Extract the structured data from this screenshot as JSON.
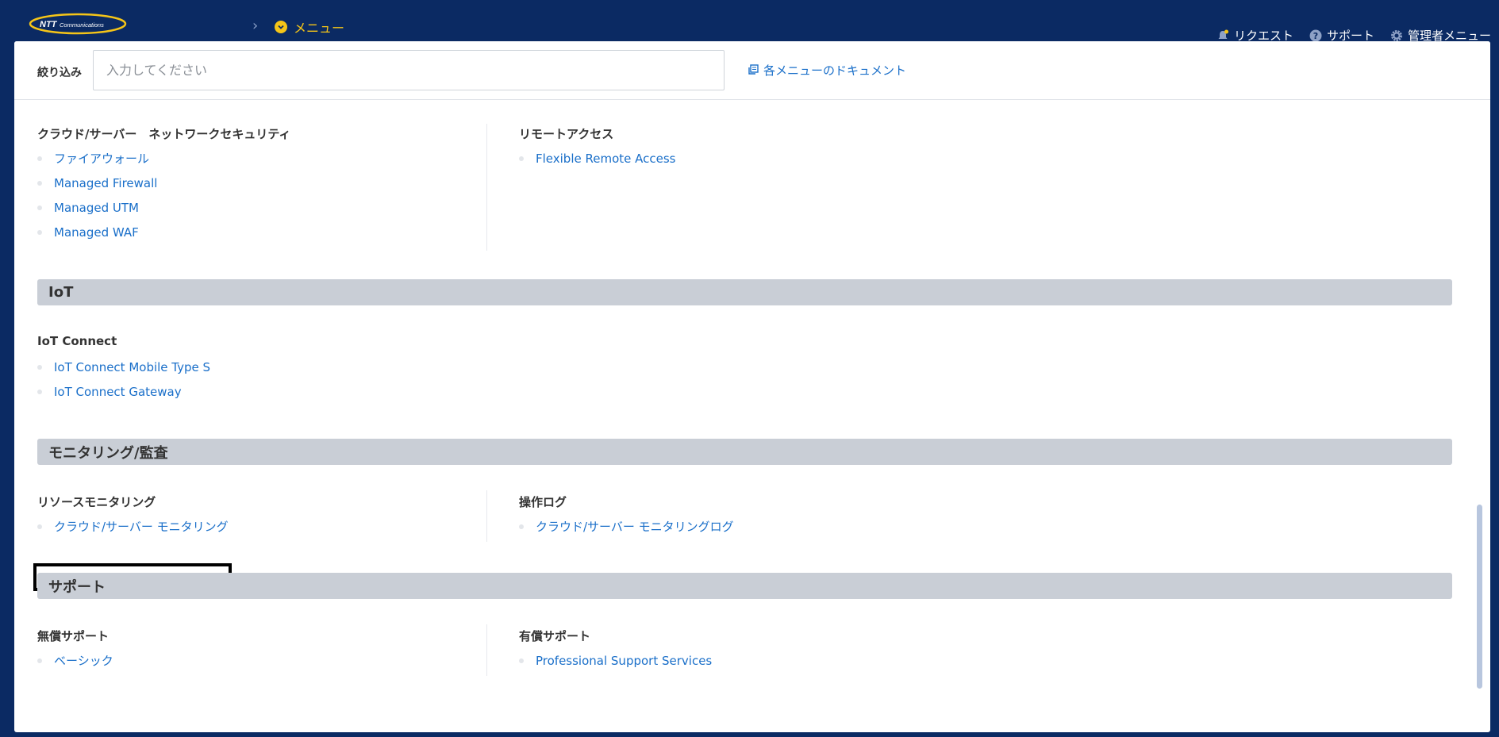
{
  "header": {
    "logo_text": "NTT Communications",
    "breadcrumb_menu": "メニュー",
    "right_items": [
      {
        "label": "リクエスト",
        "icon": "bell-icon"
      },
      {
        "label": "サポート",
        "icon": "help-icon"
      },
      {
        "label": "管理者メニュー",
        "icon": "gear-icon"
      }
    ]
  },
  "filter": {
    "label": "絞り込み",
    "placeholder": "入力してください",
    "value": "",
    "doc_link": "各メニューのドキュメント"
  },
  "groups": {
    "network_security": {
      "title": "クラウド/サーバー　ネットワークセキュリティ",
      "items": [
        "ファイアウォール",
        "Managed Firewall",
        "Managed UTM",
        "Managed WAF"
      ]
    },
    "remote_access": {
      "title": "リモートアクセス",
      "items": [
        "Flexible Remote Access"
      ]
    },
    "iot": {
      "section": "IoT",
      "title": "IoT Connect",
      "items": [
        "IoT Connect Mobile Type S",
        "IoT Connect Gateway"
      ]
    },
    "monitoring": {
      "section": "モニタリング/監査",
      "resource_title": "リソースモニタリング",
      "resource_items": [
        "クラウド/サーバー モニタリング"
      ],
      "oplog_title": "操作ログ",
      "oplog_items": [
        "クラウド/サーバー モニタリングログ"
      ]
    },
    "support": {
      "section": "サポート",
      "free_title": "無償サポート",
      "free_items": [
        "ベーシック"
      ],
      "paid_title": "有償サポート",
      "paid_items": [
        "Professional Support Services"
      ]
    }
  },
  "colors": {
    "header_bg": "#0b2a63",
    "accent_yellow": "#f5c518",
    "link": "#1a6fc9",
    "section_bar": "#c9ced6"
  }
}
